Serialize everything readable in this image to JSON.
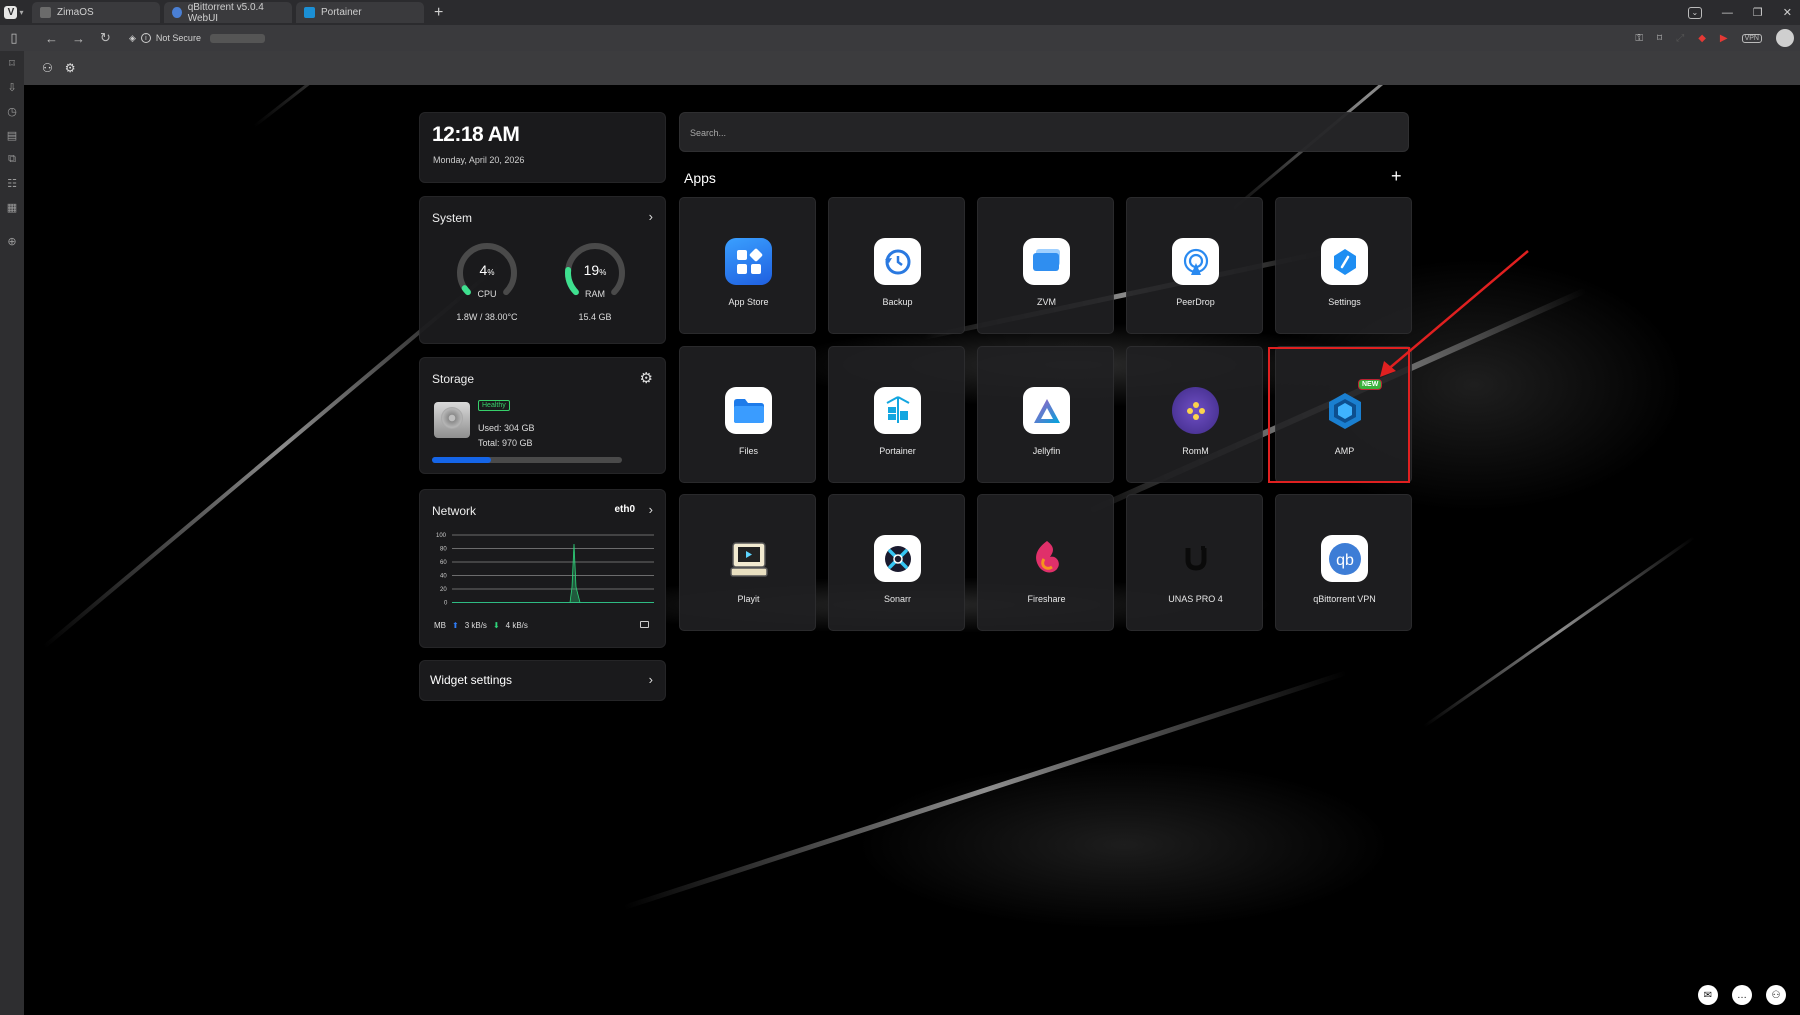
{
  "browser": {
    "tabs": [
      {
        "title": "ZimaOS"
      },
      {
        "title": "qBittorrent v5.0.4 WebUI"
      },
      {
        "title": "Portainer"
      }
    ],
    "new_tab": "+",
    "security_label": "Not Secure"
  },
  "clock": {
    "time": "12:18 AM",
    "date": "Monday, April 20, 2026"
  },
  "system": {
    "title": "System",
    "cpu": {
      "value": "4",
      "unit": "%",
      "label": "CPU",
      "detail": "1.8W / 38.00°C",
      "percent": 4
    },
    "ram": {
      "value": "19",
      "unit": "%",
      "label": "RAM",
      "detail": "15.4 GB",
      "percent": 19
    }
  },
  "storage": {
    "title": "Storage",
    "status": "Healthy",
    "used": "Used: 304 GB",
    "total": "Total: 970 GB",
    "used_fraction": 0.313
  },
  "network": {
    "title": "Network",
    "interface": "eth0",
    "y_ticks": [
      "100",
      "80",
      "60",
      "40",
      "20",
      "0"
    ],
    "unit": "MB",
    "upload": "3 kB/s",
    "download": "4 kB/s"
  },
  "widget_settings": {
    "title": "Widget settings"
  },
  "search": {
    "placeholder": "Search..."
  },
  "apps": {
    "title": "Apps",
    "add": "+",
    "new_badge": "NEW",
    "items": [
      {
        "label": "App Store",
        "icon": "app-store-icon",
        "color": "#2f7df6"
      },
      {
        "label": "Backup",
        "icon": "backup-icon",
        "color": "#ffffff"
      },
      {
        "label": "ZVM",
        "icon": "zvm-icon",
        "color": "#ffffff"
      },
      {
        "label": "PeerDrop",
        "icon": "peerdrop-icon",
        "color": "#ffffff"
      },
      {
        "label": "Settings",
        "icon": "settings-icon",
        "color": "#ffffff"
      },
      {
        "label": "Files",
        "icon": "files-icon",
        "color": "#ffffff"
      },
      {
        "label": "Portainer",
        "icon": "portainer-icon",
        "color": "#ffffff"
      },
      {
        "label": "Jellyfin",
        "icon": "jellyfin-icon",
        "color": "#ffffff"
      },
      {
        "label": "RomM",
        "icon": "romm-icon",
        "color": "#5b3ea8"
      },
      {
        "label": "AMP",
        "icon": "amp-icon",
        "color": "#1a8bd8"
      },
      {
        "label": "Playit",
        "icon": "playit-icon",
        "color": "#f2ead0"
      },
      {
        "label": "Sonarr",
        "icon": "sonarr-icon",
        "color": "#ffffff"
      },
      {
        "label": "Fireshare",
        "icon": "fireshare-icon",
        "color": "#e0306a"
      },
      {
        "label": "UNAS PRO 4",
        "icon": "unas-icon",
        "color": "#111111"
      },
      {
        "label": "qBittorrent VPN",
        "icon": "qbittorrent-icon",
        "color": "#ffffff"
      }
    ]
  }
}
